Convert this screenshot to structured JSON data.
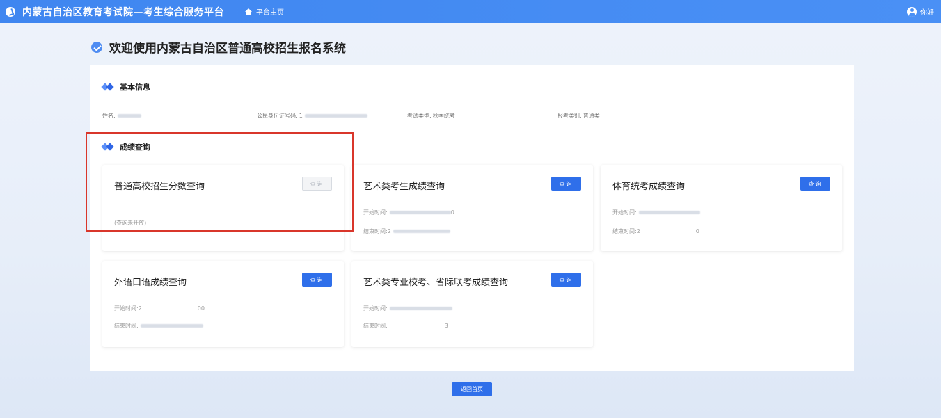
{
  "header": {
    "app_title": "内蒙古自治区教育考试院—考生综合服务平台",
    "home_label": "平台主页",
    "user_label": "你好"
  },
  "page": {
    "title": "欢迎使用内蒙古自治区普通高校招生报名系统"
  },
  "basic_info": {
    "section_title": "基本信息",
    "name_label": "姓名:",
    "id_label": "公民身份证号码:",
    "id_prefix": "1",
    "exam_type_label": "考试类型:",
    "exam_type_value": "秋季统考",
    "category_label": "报考类别:",
    "category_value": "普通类"
  },
  "scores": {
    "section_title": "成绩查询",
    "start_label": "开始时间:",
    "end_label": "结束时间:",
    "query_label": "查询",
    "cards": [
      {
        "title": "普通高校招生分数查询",
        "status": "(查询未开放)"
      },
      {
        "title": "艺术类考生成绩查询",
        "start_tail": "0",
        "end_prefix": "2"
      },
      {
        "title": "体育统考成绩查询",
        "start_tail": "",
        "end_prefix": "2",
        "end_tail": "0"
      },
      {
        "title": "外语口语成绩查询",
        "start_prefix": "2",
        "start_tail": "00"
      },
      {
        "title": "艺术类专业校考、省际联考成绩查询",
        "end_tail": "3"
      }
    ]
  },
  "footer": {
    "back_label": "返回首页"
  },
  "colors": {
    "topbar": "#4a90f5",
    "primary_button": "#2f6fea",
    "highlight": "#d9362b"
  }
}
